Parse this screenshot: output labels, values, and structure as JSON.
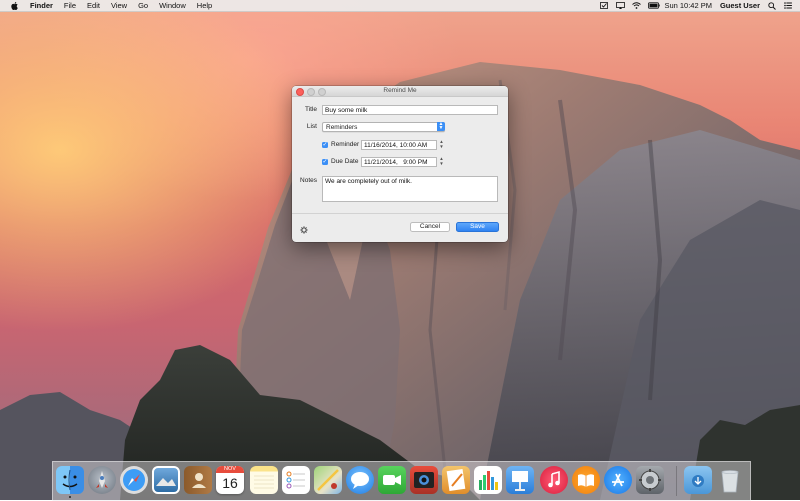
{
  "menubar": {
    "app_name": "Finder",
    "menus": [
      "File",
      "Edit",
      "View",
      "Go",
      "Window",
      "Help"
    ],
    "clock": "Sun 10:42 PM",
    "user": "Guest User"
  },
  "dialog": {
    "title": "Remind Me",
    "title_label": "Title",
    "title_value": "Buy some milk",
    "list_label": "List",
    "list_value": "Reminders",
    "reminder_label": "Reminder",
    "reminder_checked": true,
    "reminder_value": "11/16/2014, 10:00 AM",
    "due_label": "Due Date",
    "due_checked": true,
    "due_value": "11/21/2014,   9:00 PM",
    "notes_label": "Notes",
    "notes_value": "We are completely out of milk.",
    "cancel_label": "Cancel",
    "save_label": "Save"
  },
  "dock": {
    "calendar_month": "NOV",
    "calendar_day": "16",
    "apps": [
      "Finder",
      "Launchpad",
      "Safari",
      "Mail",
      "Contacts",
      "Calendar",
      "Notes",
      "Reminders",
      "Maps",
      "Messages",
      "FaceTime",
      "Photo Booth",
      "iPhoto",
      "Pages",
      "Numbers",
      "Keynote",
      "iTunes",
      "iBooks",
      "App Store",
      "System Preferences",
      "Downloads",
      "Trash"
    ]
  },
  "colors": {
    "accent": "#3b8ff6",
    "close": "#fc605c"
  }
}
